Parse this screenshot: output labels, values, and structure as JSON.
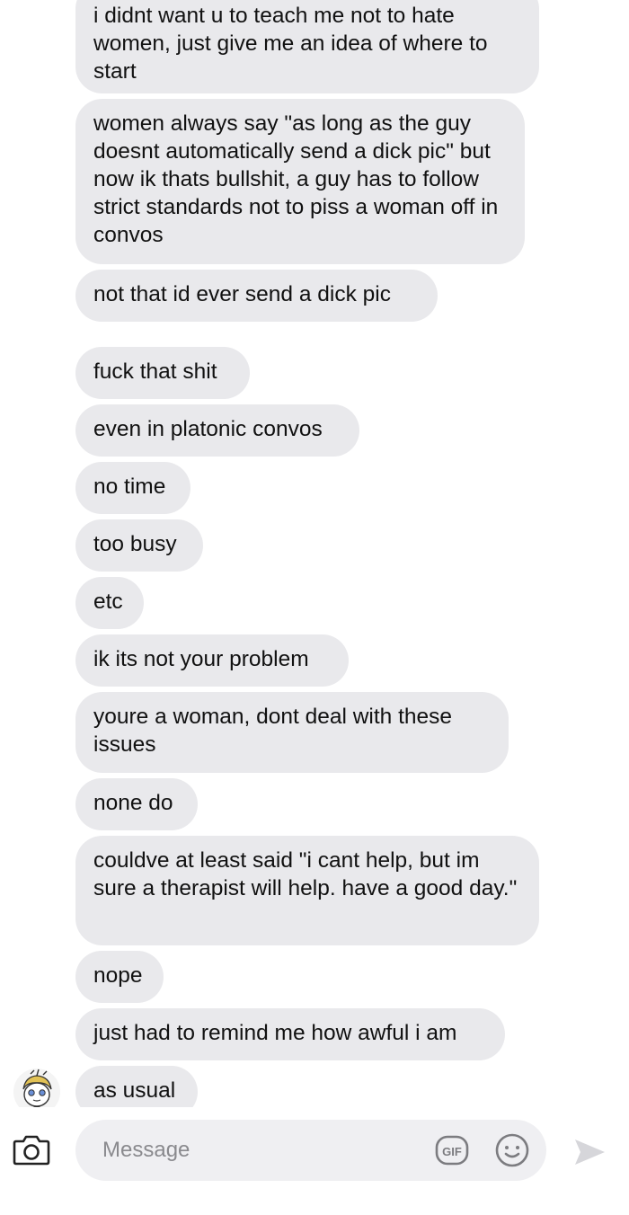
{
  "messages": [
    "i didnt want u to teach me not to hate women, just give me an idea of where to start",
    "women always say \"as long as the guy doesnt automatically send a dick pic\" but now ik thats bullshit, a guy has to follow strict standards not to piss a woman off in convos",
    "not that id ever send a dick pic",
    "fuck that shit",
    "even in platonic convos",
    "no time",
    "too busy",
    "etc",
    "ik its not your problem",
    "youre a woman, dont deal with these issues",
    "none do",
    "couldve at least said \"i cant help, but im sure a therapist will help. have a good day.\"",
    "nope",
    "just had to remind me how awful i am",
    "as usual"
  ],
  "composer": {
    "placeholder": "Message",
    "gif_label": "GIF"
  },
  "icons": {
    "camera": "camera-icon",
    "gif": "gif-icon",
    "emoji": "emoji-icon",
    "send": "send-icon",
    "avatar": "avatar"
  },
  "colors": {
    "bubble": "#e9e9ec",
    "composer": "#efeff2",
    "placeholder": "#8a8a8e",
    "icon": "#7c7c80",
    "send": "#d6d6da"
  }
}
